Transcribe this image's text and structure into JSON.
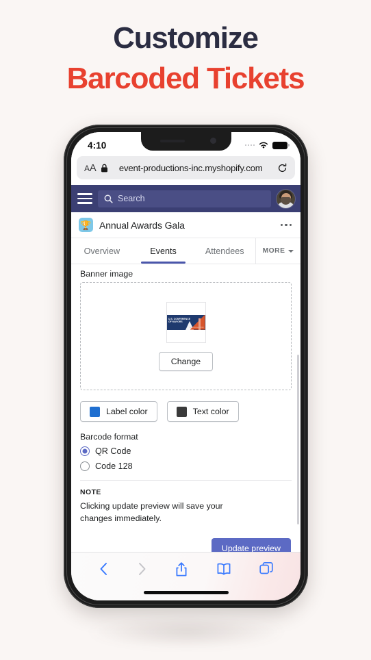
{
  "headline": {
    "line1": "Customize",
    "line2": "Barcoded Tickets",
    "line1_color": "#2b2d42",
    "line2_color": "#e8412f"
  },
  "phone": {
    "status_bar": {
      "time": "4:10",
      "wifi_icon": "wifi-icon",
      "battery_icon": "battery-full-icon",
      "signal_icon": "signal-dots-icon"
    },
    "browser": {
      "aa_label": "AA",
      "lock_icon": "lock-icon",
      "url": "event-productions-inc.myshopify.com",
      "reload_icon": "reload-icon",
      "toolbar": {
        "back_icon": "back-chevron-icon",
        "forward_icon": "forward-chevron-icon",
        "share_icon": "share-icon",
        "bookmarks_icon": "book-icon",
        "tabs_icon": "tabs-icon"
      }
    }
  },
  "shop_nav": {
    "menu_icon": "hamburger-menu-icon",
    "search_icon": "search-icon",
    "search_placeholder": "Search",
    "avatar": "user-avatar",
    "background": "#3b3f73"
  },
  "app_header": {
    "icon": "trophy-app-icon",
    "icon_glyph": "🏆",
    "title": "Annual Awards Gala",
    "more_icon": "ellipsis-icon"
  },
  "tabs": {
    "items": [
      {
        "label": "Overview",
        "active": false
      },
      {
        "label": "Events",
        "active": true
      },
      {
        "label": "Attendees",
        "active": false
      }
    ],
    "more_label": "MORE",
    "more_icon": "chevron-down-icon",
    "active_color": "#4a56ab"
  },
  "form": {
    "banner_label": "Banner image",
    "thumbnail": {
      "title_line1": "U.S. CONFERENCE",
      "title_line2": "OF MAYORS",
      "caption": "San Francisco 2019",
      "background": "#1f3a6e",
      "bridge_color": "#d8552c"
    },
    "change_button": "Change",
    "label_color_button": "Label color",
    "label_color_value": "#1f6fd0",
    "text_color_button": "Text color",
    "text_color_value": "#3a3a3a",
    "barcode_format_label": "Barcode format",
    "barcode_options": [
      {
        "label": "QR Code",
        "selected": true
      },
      {
        "label": "Code 128",
        "selected": false
      }
    ],
    "note_title": "NOTE",
    "note_body": "Clicking update preview will save your changes immediately.",
    "update_button": "Update preview",
    "update_button_color": "#5c6ac4"
  }
}
